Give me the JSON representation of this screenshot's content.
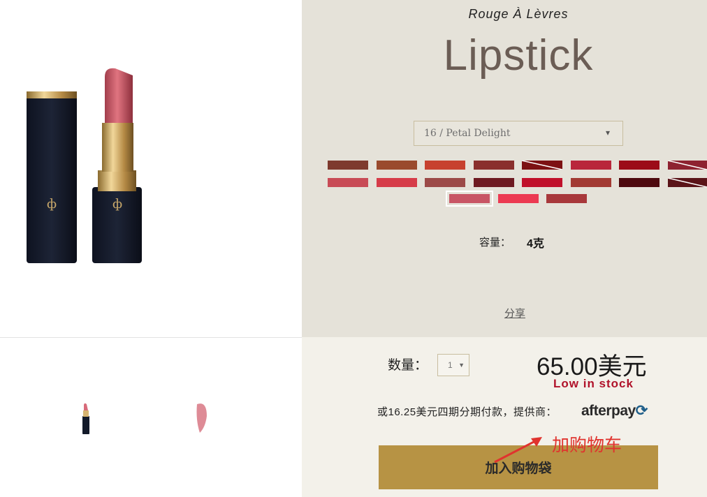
{
  "product": {
    "subtitle": "Rouge À Lèvres",
    "title": "Lipstick"
  },
  "shade_select": {
    "value": "16 / Petal Delight"
  },
  "swatches": [
    {
      "color": "#7e3a2e"
    },
    {
      "color": "#9a4a2d"
    },
    {
      "color": "#c7412f"
    },
    {
      "color": "#8a2f2d"
    },
    {
      "color": "#7d1113"
    },
    {
      "color": "#b9263b"
    },
    {
      "color": "#9c0c18"
    },
    {
      "color": "#8e2231"
    },
    {
      "color": "#c84b56"
    },
    {
      "color": "#d63c49"
    },
    {
      "color": "#9c4a48"
    },
    {
      "color": "#6e1a21"
    },
    {
      "color": "#c0102a"
    },
    {
      "color": "#a23a33"
    },
    {
      "color": "#4e0a0f"
    },
    {
      "color": "#5a1418"
    },
    {
      "color": "#c85565"
    },
    {
      "color": "#ec3a52"
    },
    {
      "color": "#a8383b"
    }
  ],
  "capacity": {
    "label": "容量：",
    "value": "4克"
  },
  "share_label": "分享",
  "quantity": {
    "label": "数量：",
    "value": "1"
  },
  "price": "65.00美元",
  "stock_status": "Low in stock",
  "installment_text": "或16.25美元四期分期付款，提供商：",
  "afterpay_logo": "afterpay",
  "add_to_bag_label": "加入购物袋",
  "annotation_text": "加购物车",
  "colors": {
    "info_bg": "#e5e2d9",
    "buy_bg": "#f3f1ea",
    "button_gold": "#b79344",
    "stock_red": "#b0122a",
    "annotation_red": "#e0332e"
  }
}
